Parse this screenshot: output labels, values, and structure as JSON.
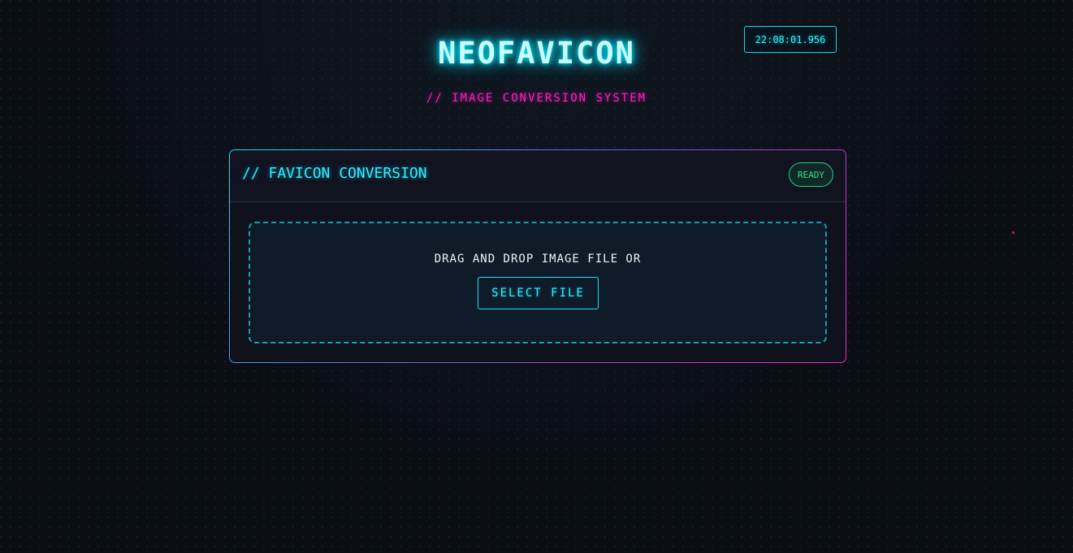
{
  "header": {
    "title": "NEOFAVICON",
    "subtitle": "// IMAGE CONVERSION SYSTEM",
    "clock": "22:08:01.956"
  },
  "panel": {
    "title": "// FAVICON CONVERSION",
    "status": "READY",
    "dropzone": {
      "text": "DRAG AND DROP IMAGE FILE OR",
      "button_label": "SELECT FILE"
    }
  },
  "colors": {
    "background": "#0c0e16",
    "cyan": "#2ef0ff",
    "magenta": "#ff1fc0",
    "status_green": "#2ce38a",
    "red_dot": "#e0202e"
  }
}
